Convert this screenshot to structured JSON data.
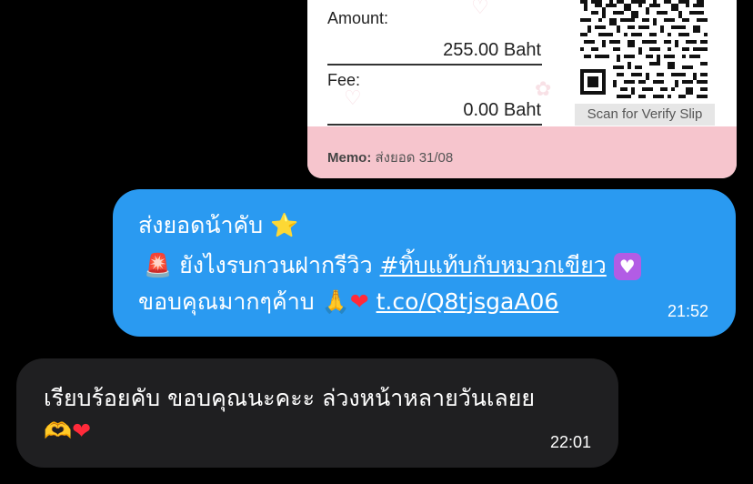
{
  "slip": {
    "amount_label": "Amount:",
    "amount_value": "255.00 Baht",
    "fee_label": "Fee:",
    "fee_value": "0.00 Baht",
    "qr_caption": "Scan for Verify Slip",
    "memo_label": "Memo:",
    "memo_value": "ส่งยอด 31/08"
  },
  "outgoing_message": {
    "line1_text": "ส่งยอดน้าคับ",
    "line1_emoji": "⭐",
    "line2_emoji_start": "🚨",
    "line2_text": "ยังไงรบกวนฝากรีวิว",
    "line2_hashtag": "#ทิ้บแท้บกับหมวกเขียว",
    "line2_emoji_end": "♥",
    "line3_text": "ขอบคุณมากๆค้าบ",
    "line3_emoji": "🙏",
    "line3_heart": "❤",
    "line3_link": "t.co/Q8tjsgaA06",
    "time": "21:52"
  },
  "incoming_message": {
    "line1_text": "เรียบร้อยคับ ขอบคุณนะคะะ ล่วงหน้าหลายวันเลยย",
    "line2_emoji": "🫶",
    "line2_heart": "❤",
    "time": "22:01"
  },
  "colors": {
    "outgoing_bubble": "#2a9af1",
    "incoming_bubble": "#1f1f21",
    "memo_bar": "#f6c5cd",
    "background": "#000000"
  }
}
